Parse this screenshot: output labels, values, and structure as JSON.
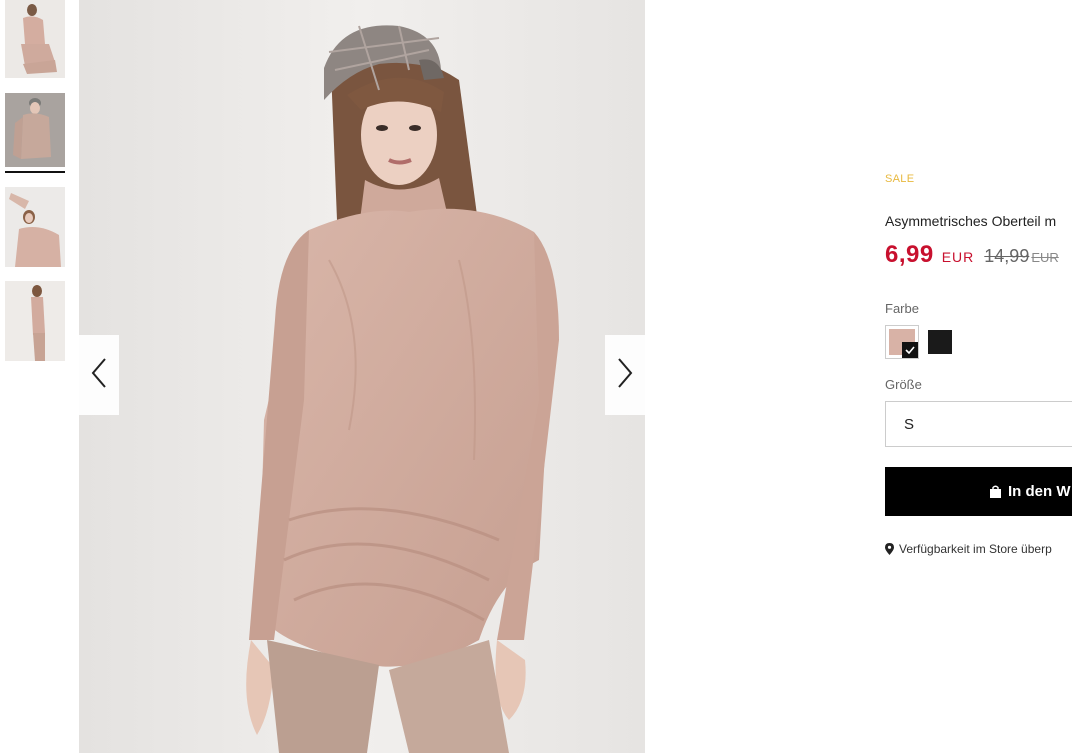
{
  "gallery": {
    "thumbnails": [
      "thumbnail-1",
      "thumbnail-2",
      "thumbnail-3",
      "thumbnail-4"
    ],
    "active_index": 1
  },
  "product": {
    "badge": "SALE",
    "title": "Asymmetrisches Oberteil m",
    "price_new": "6,99",
    "currency_new": "EUR",
    "price_old": "14,99",
    "currency_old": "EUR"
  },
  "color": {
    "label": "Farbe",
    "options": [
      {
        "name": "rosa",
        "hex": "#d8b2a6",
        "selected": true
      },
      {
        "name": "schwarz",
        "hex": "#1a1a1a",
        "selected": false
      }
    ]
  },
  "size": {
    "label": "Größe",
    "selected": "S"
  },
  "cart_button": {
    "label": "In den W"
  },
  "store_link": {
    "label": "Verfügbarkeit im Store überp"
  },
  "colors": {
    "sale": "#e8b93f",
    "price": "#c8102e",
    "product": "#d8b2a6"
  }
}
